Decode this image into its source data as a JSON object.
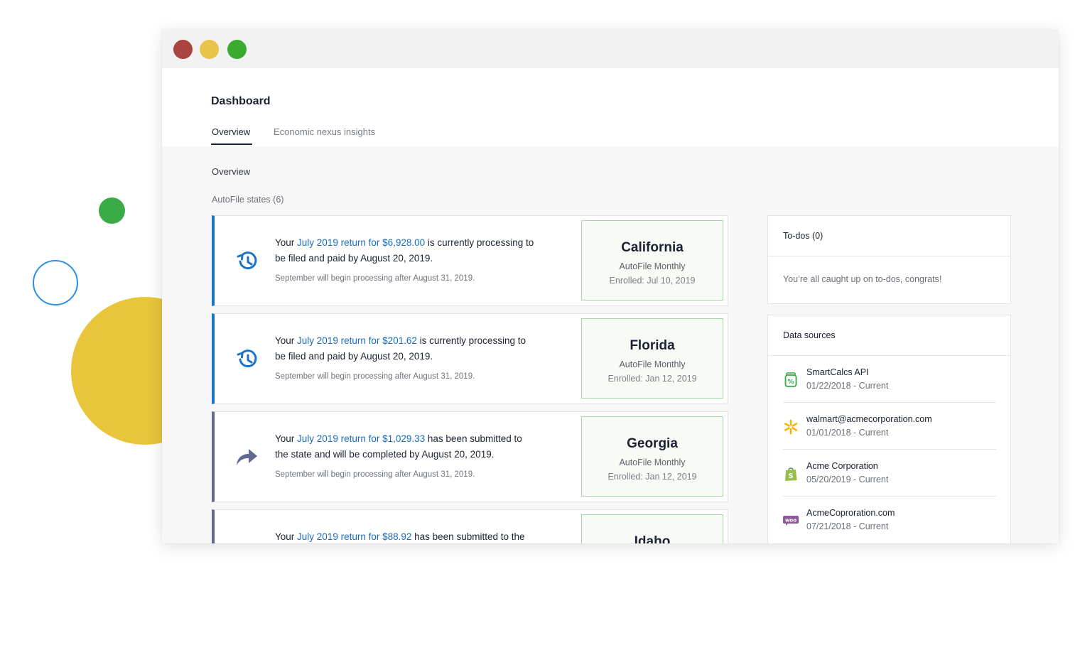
{
  "window": {
    "controls": [
      "close",
      "minimize",
      "maximize"
    ]
  },
  "header": {
    "title": "Dashboard",
    "tabs": [
      {
        "label": "Overview",
        "active": true
      },
      {
        "label": "Economic nexus insights",
        "active": false
      }
    ]
  },
  "main": {
    "section_title": "Overview",
    "autofile_label": "AutoFile states (6)",
    "cards": [
      {
        "status": "processing",
        "icon": "history-icon",
        "text_before": "Your ",
        "link": "July 2019 return for $6,928.00",
        "text_after": " is currently processing to be filed and paid by August 20, 2019.",
        "note": "September will begin processing after August 31, 2019.",
        "state": "California",
        "plan": "AutoFile Monthly",
        "enrolled": "Enrolled: Jul 10, 2019"
      },
      {
        "status": "processing",
        "icon": "history-icon",
        "text_before": "Your ",
        "link": "July 2019 return for $201.62",
        "text_after": " is currently processing to be filed and paid by August 20, 2019.",
        "note": "September will begin processing after August 31, 2019.",
        "state": "Florida",
        "plan": "AutoFile Monthly",
        "enrolled": "Enrolled: Jan 12, 2019"
      },
      {
        "status": "submitted",
        "icon": "share-arrow-icon",
        "text_before": "Your ",
        "link": "July 2019 return for $1,029.33",
        "text_after": " has been submitted to the state and will be completed by August 20, 2019.",
        "note": "September will begin processing after August 31, 2019.",
        "state": "Georgia",
        "plan": "AutoFile Monthly",
        "enrolled": "Enrolled: Jan 12, 2019"
      },
      {
        "status": "submitted",
        "icon": "share-arrow-icon",
        "text_before": "Your ",
        "link": "July 2019 return for $88.92",
        "text_after": " has been submitted to the",
        "note": "",
        "state": "Idaho",
        "plan": "",
        "enrolled": ""
      }
    ]
  },
  "sidebar": {
    "todos": {
      "title": "To-dos (0)",
      "message": "You’re all caught up on to-dos, congrats!"
    },
    "data_sources": {
      "title": "Data sources",
      "items": [
        {
          "icon": "smartcalcs-icon",
          "name": "SmartCalcs API",
          "dates": "01/22/2018 - Current",
          "color": "#3aab47"
        },
        {
          "icon": "walmart-spark-icon",
          "name": "walmart@acmecorporation.com",
          "dates": "01/01/2018 - Current",
          "color": "#f7b500"
        },
        {
          "icon": "shopify-bag-icon",
          "name": "Acme Corporation",
          "dates": "05/20/2019 - Current",
          "color": "#95bf47"
        },
        {
          "icon": "woo-icon",
          "name": "AcmeCoproration.com",
          "dates": "07/21/2018 - Current",
          "color": "#8e5a9c"
        }
      ]
    }
  },
  "colors": {
    "link": "#1a6bbf",
    "processing_accent": "#1a73c8",
    "submitted_accent": "#616b91",
    "state_border": "#a8d6a8"
  }
}
